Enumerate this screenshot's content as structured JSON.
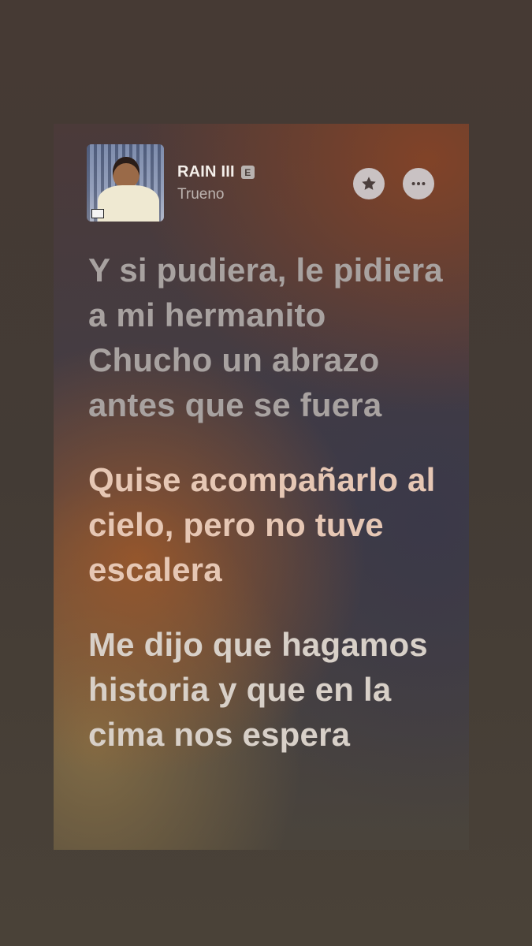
{
  "track": {
    "title": "RAIN III",
    "explicit_badge": "E",
    "artist": "Trueno"
  },
  "actions": {
    "favorite_icon": "star-icon",
    "more_icon": "ellipsis-icon"
  },
  "lyrics": {
    "lines": [
      "Y si pudiera, le pidiera a mi hermanito Chucho un abrazo antes que se fuera",
      "Quise acompañarlo al cielo, pero no tuve escalera",
      "Me dijo que hagamos historia y que en la cima nos espera"
    ]
  },
  "colors": {
    "past_line": "#a8a2a0",
    "active_line": "#e6c7b4",
    "upcoming_line": "#d8d0c8",
    "button_background": "#c9c2c3"
  }
}
